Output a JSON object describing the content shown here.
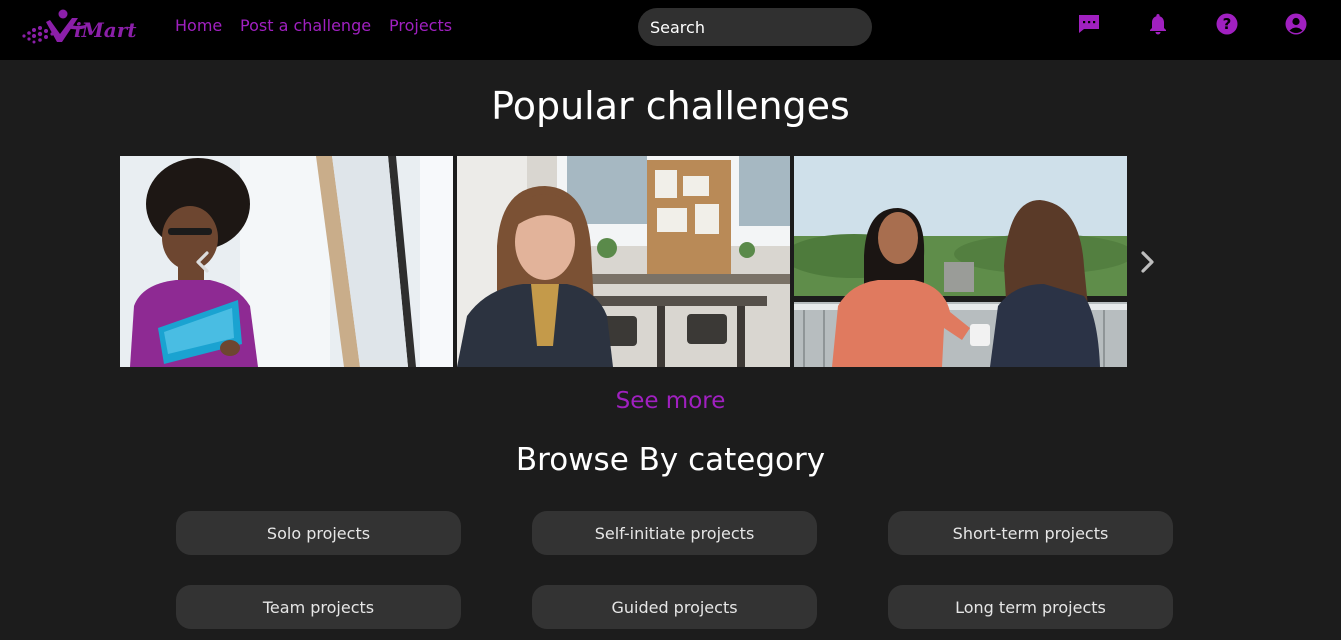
{
  "header": {
    "logo_text": "iMart",
    "nav": [
      "Home",
      "Post a challenge",
      "Projects"
    ],
    "search_placeholder": "Search",
    "icons": [
      "message-icon",
      "bell-icon",
      "help-icon",
      "account-icon"
    ]
  },
  "popular": {
    "title": "Popular challenges",
    "see_more": "See more"
  },
  "browse": {
    "title": "Browse By category",
    "categories": [
      "Solo projects",
      "Self-initiate projects",
      "Short-term projects",
      "Team projects",
      "Guided projects",
      "Long term projects"
    ]
  },
  "colors": {
    "accent": "#a020c0",
    "background": "#1c1c1c",
    "topbar": "#000000",
    "button": "#333333"
  }
}
